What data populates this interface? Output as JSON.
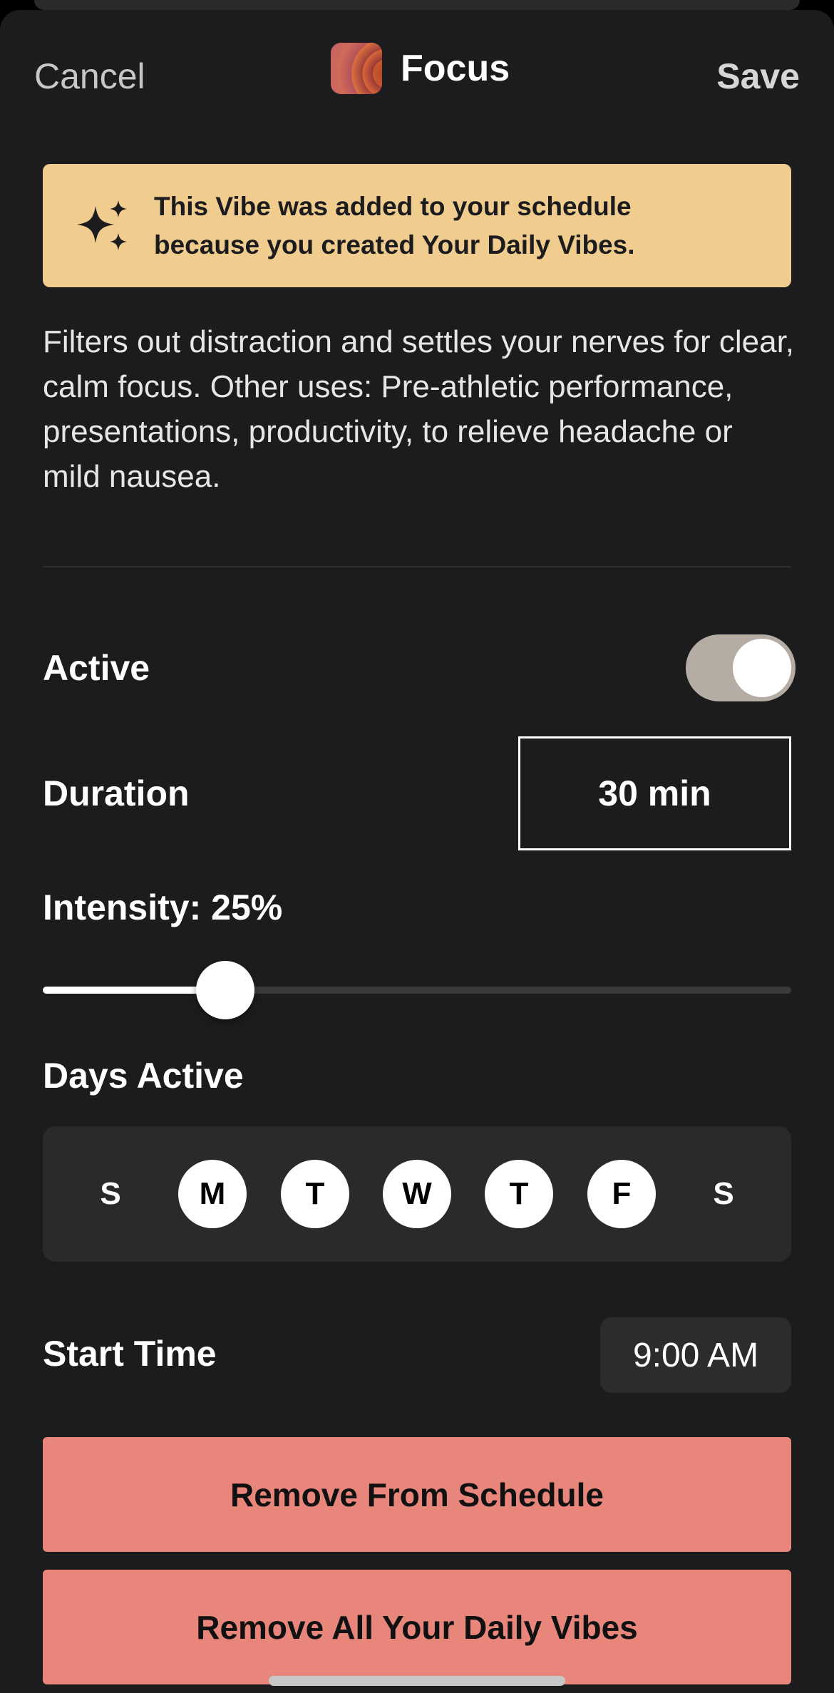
{
  "nav": {
    "cancel_label": "Cancel",
    "title": "Focus",
    "save_label": "Save"
  },
  "banner": {
    "text": "This Vibe was added to your schedule because you created Your Daily Vibes.",
    "icon": "sparkles-icon",
    "color": "#f0cc8e"
  },
  "description": "Filters out distraction and settles your nerves for clear, calm focus. Other uses: Pre-athletic performance, presentations, productivity, to relieve headache or mild nausea.",
  "active": {
    "label": "Active",
    "value": true
  },
  "duration": {
    "label": "Duration",
    "value": "30 min"
  },
  "intensity": {
    "label": "Intensity: 25%",
    "value": 25,
    "max": 100
  },
  "days": {
    "label": "Days Active",
    "items": [
      {
        "letter": "S",
        "active": false
      },
      {
        "letter": "M",
        "active": true
      },
      {
        "letter": "T",
        "active": true
      },
      {
        "letter": "W",
        "active": true
      },
      {
        "letter": "T",
        "active": true
      },
      {
        "letter": "F",
        "active": true
      },
      {
        "letter": "S",
        "active": false
      }
    ]
  },
  "start_time": {
    "label": "Start Time",
    "value": "9:00 AM"
  },
  "actions": {
    "remove_schedule_label": "Remove From Schedule",
    "remove_all_label": "Remove All Your Daily Vibes",
    "color": "#e8867c"
  }
}
